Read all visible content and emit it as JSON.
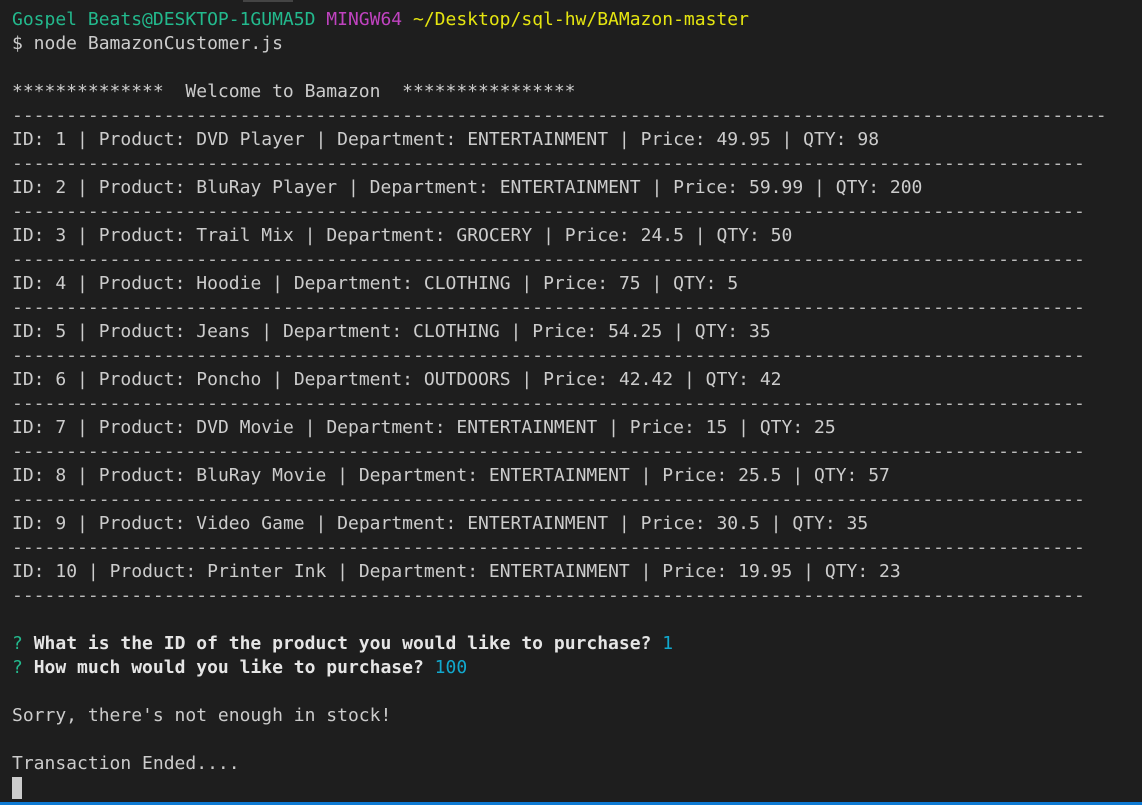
{
  "prompt": {
    "user": "Gospel Beats@DESKTOP-1GUMA5D",
    "system": "MINGW64",
    "path": "~/Desktop/sql-hw/BAMazon-master"
  },
  "command": "$ node BamazonCustomer.js",
  "welcome": "**************  Welcome to Bamazon  ****************",
  "labels": {
    "id": "ID: ",
    "product": "Product: ",
    "department": "Department: ",
    "price": "Price: ",
    "qty": "QTY: ",
    "sep": " | "
  },
  "products": [
    {
      "id": "1",
      "product": "DVD Player",
      "department": "ENTERTAINMENT",
      "price": "49.95",
      "qty": "98"
    },
    {
      "id": "2",
      "product": "BluRay Player",
      "department": "ENTERTAINMENT",
      "price": "59.99",
      "qty": "200"
    },
    {
      "id": "3",
      "product": "Trail Mix",
      "department": "GROCERY",
      "price": "24.5",
      "qty": "50"
    },
    {
      "id": "4",
      "product": "Hoodie",
      "department": "CLOTHING",
      "price": "75",
      "qty": "5"
    },
    {
      "id": "5",
      "product": "Jeans",
      "department": "CLOTHING",
      "price": "54.25",
      "qty": "35"
    },
    {
      "id": "6",
      "product": "Poncho",
      "department": "OUTDOORS",
      "price": "42.42",
      "qty": "42"
    },
    {
      "id": "7",
      "product": "DVD Movie",
      "department": "ENTERTAINMENT",
      "price": "15",
      "qty": "25"
    },
    {
      "id": "8",
      "product": "BluRay Movie",
      "department": "ENTERTAINMENT",
      "price": "25.5",
      "qty": "57"
    },
    {
      "id": "9",
      "product": "Video Game",
      "department": "ENTERTAINMENT",
      "price": "30.5",
      "qty": "35"
    },
    {
      "id": "10",
      "product": "Printer Ink",
      "department": "ENTERTAINMENT",
      "price": "19.95",
      "qty": "23"
    }
  ],
  "questions": [
    {
      "mark": "?",
      "text": "What is the ID of the product you would like to purchase?",
      "answer": "1"
    },
    {
      "mark": "?",
      "text": "How much would you like to purchase?",
      "answer": "100"
    }
  ],
  "message": "Sorry, there's not enough in stock!",
  "ended": "Transaction Ended...."
}
